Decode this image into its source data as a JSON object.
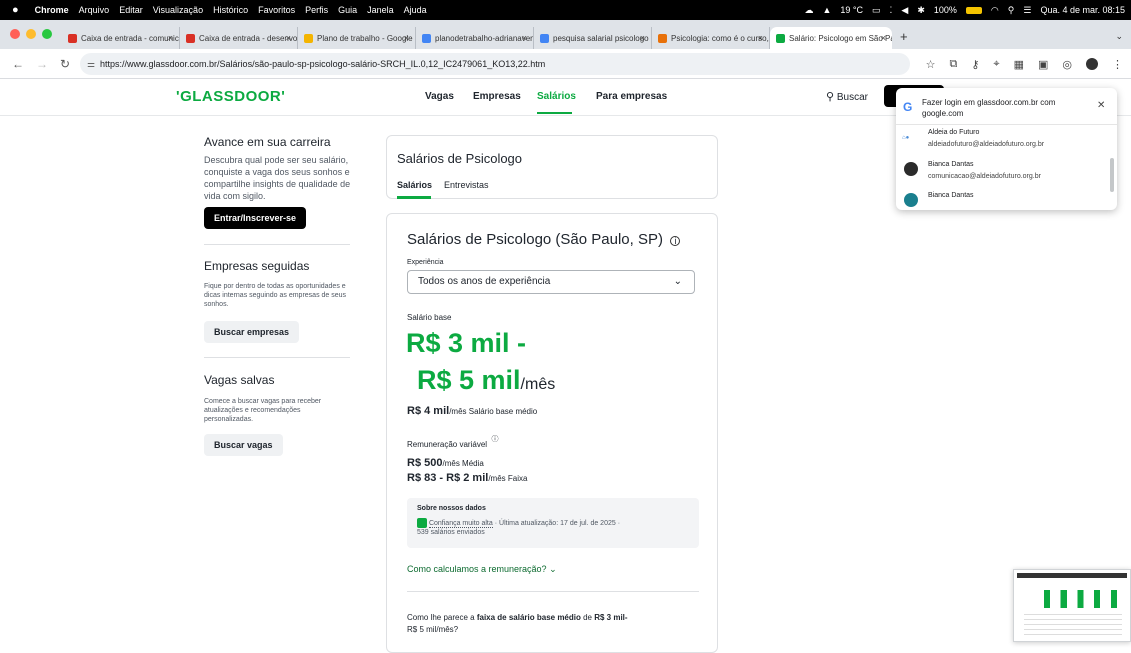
{
  "menubar": {
    "app": "Chrome",
    "menus": [
      "Arquivo",
      "Editar",
      "Visualização",
      "Histórico",
      "Favoritos",
      "Perfis",
      "Guia",
      "Janela",
      "Ajuda"
    ],
    "weather": "19 °C",
    "battery": "100%",
    "datetime": "Qua. 4 de mar. 08:15"
  },
  "tabs": [
    {
      "title": "Caixa de entrada - comunica",
      "color": "#d93025"
    },
    {
      "title": "Caixa de entrada - desenvolv",
      "color": "#d93025"
    },
    {
      "title": "Plano de trabalho - Google D",
      "color": "#f4b400"
    },
    {
      "title": "planodetrabalho-adrianavent",
      "color": "#4285f4"
    },
    {
      "title": "pesquisa salarial psicologo -",
      "color": "#4285f4"
    },
    {
      "title": "Psicologia: como é o curso, c",
      "color": "#e8710a"
    },
    {
      "title": "Salário: Psicologo em São Pa",
      "color": "#0caa41"
    }
  ],
  "url": "https://www.glassdoor.com.br/Salários/são-paulo-sp-psicologo-salário-SRCH_IL.0,12_IC2479061_KO13,22.htm",
  "site": {
    "logo": "'GLASSDOOR'",
    "nav": [
      "Vagas",
      "Empresas",
      "Salários",
      "Para empresas"
    ],
    "search": "Buscar"
  },
  "sidebar": {
    "career_title": "Avance em sua carreira",
    "career_text": "Descubra qual pode ser seu salário, conquiste a vaga dos seus sonhos e compartilhe insights de qualidade de vida com sigilo.",
    "login_btn": "Entrar/Inscrever-se",
    "companies_title": "Empresas seguidas",
    "companies_text": "Fique por dentro de todas as oportunidades e dicas internas seguindo as empresas de seus sonhos.",
    "companies_btn": "Buscar empresas",
    "jobs_title": "Vagas salvas",
    "jobs_text": "Comece a buscar vagas para receber atualizações e recomendações personalizadas.",
    "jobs_btn": "Buscar vagas"
  },
  "header_card": {
    "title": "Salários de Psicologo",
    "tab_salaries": "Salários",
    "tab_interviews": "Entrevistas"
  },
  "main": {
    "title": "Salários de Psicologo (São Paulo, SP)",
    "exp_label": "Experiência",
    "exp_value": "Todos os anos de experiência",
    "base_label": "Salário base",
    "range_line1": "R$ 3 mil -",
    "range_line2": "R$ 5 mil",
    "range_unit": "/mês",
    "median_value": "R$ 4 mil",
    "median_suffix": "/mês Salário base médio",
    "variable_label": "Remuneração variável",
    "var_avg_value": "R$ 500",
    "var_avg_suffix": "/mês Média",
    "var_range_value": "R$ 83 - R$ 2 mil",
    "var_range_suffix": "/mês Faixa",
    "data_title": "Sobre nossos dados",
    "confidence": "Confiança muito alta",
    "update": "· Última atualização: 17 de jul. de 2025 ·",
    "submitted": "539 salários enviados",
    "calc_link": "Como calculamos a remuneração?",
    "question_pre": "Como lhe parece a ",
    "question_bold": "faixa de salário base médio",
    "question_mid": " de ",
    "question_range": "R$ 3 mil-",
    "question_line2": "R$ 5 mil/mês?"
  },
  "popup": {
    "title": "Fazer login em glassdoor.com.br com google.com",
    "accounts": [
      {
        "name": "Aldeia do Futuro",
        "email": "aldeiadofuturo@aldeiadofuturo.org.br"
      },
      {
        "name": "Bianca Dantas",
        "email": "comunicacao@aldeiadofuturo.org.br"
      },
      {
        "name": "Bianca Dantas",
        "email": ""
      }
    ]
  },
  "colors": {
    "brand": "#0caa41",
    "text": "#20262e"
  }
}
